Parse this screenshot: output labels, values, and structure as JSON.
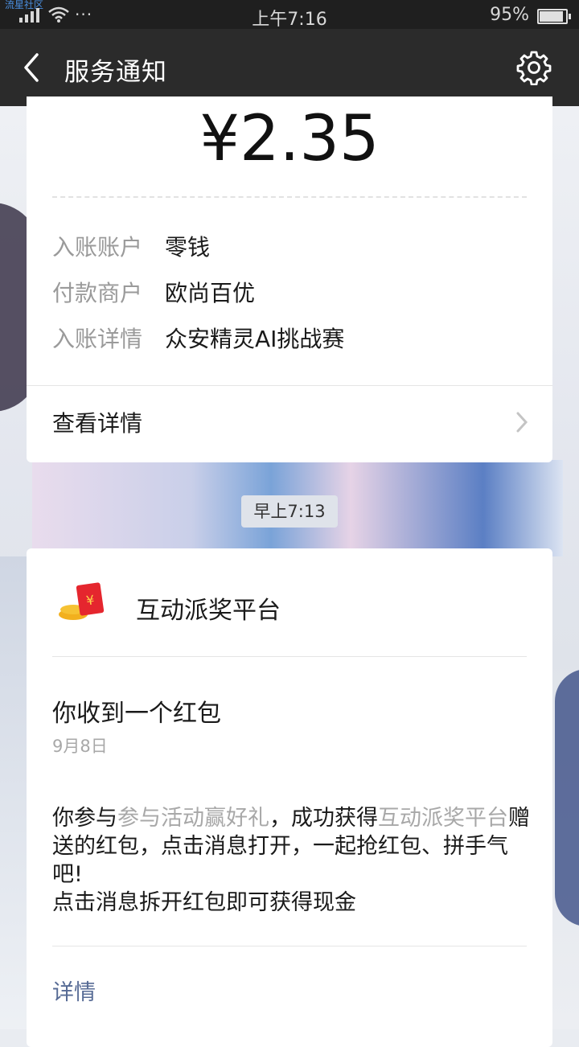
{
  "status_bar": {
    "brand": "流星社区",
    "network": "4G\n2G",
    "dots": "···",
    "time": "上午7:16",
    "battery": "95%",
    "battery_level": 0.95
  },
  "nav": {
    "title": "服务通知",
    "back_icon": "chevron-left-icon",
    "settings_icon": "gear-icon"
  },
  "payment": {
    "amount": "¥2.35",
    "rows": [
      {
        "label": "入账账户",
        "value": "零钱"
      },
      {
        "label": "付款商户",
        "value": "欧尚百优"
      },
      {
        "label": "入账详情",
        "value": "众安精灵AI挑战赛"
      }
    ],
    "detail_link": "查看详情"
  },
  "timestamp": "早上7:13",
  "redpacket": {
    "platform": "互动派奖平台",
    "title": "你收到一个红包",
    "date": "9月8日",
    "body_1": "你参与",
    "body_activity": "参与活动赢好礼",
    "body_2": "，成功获得",
    "body_platform": "互动派奖平台",
    "body_3": "赠送的红包，点击消息打开，一起抢红包、拼手气吧!",
    "body_4": "点击消息拆开红包即可获得现金",
    "more": "详情"
  },
  "colors": {
    "link": "#576b95",
    "nav_bg": "#2b2b2b",
    "status_bg": "#1f1f1f"
  }
}
